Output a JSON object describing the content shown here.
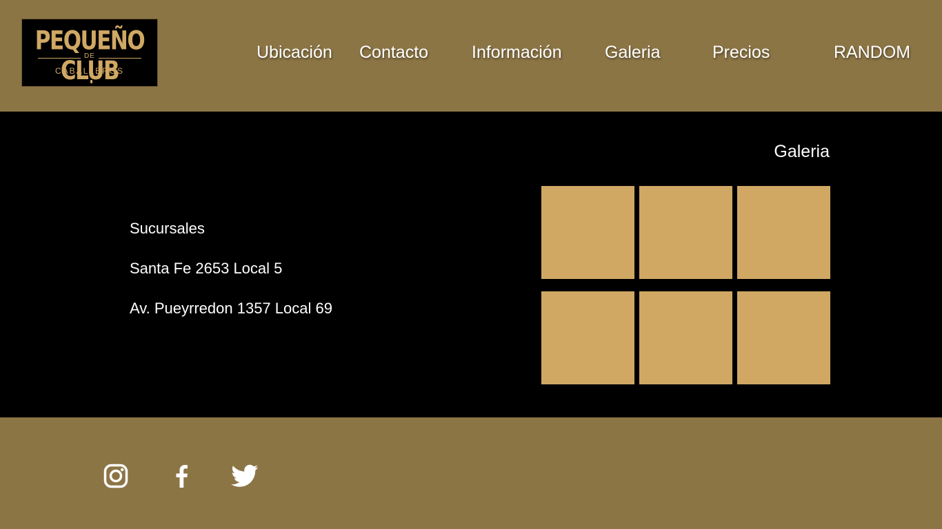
{
  "brand": {
    "logo_line1": "PEQUEÑO CLUB",
    "logo_line2": "DE",
    "logo_line3": "CABALLEROS"
  },
  "nav": {
    "items": [
      "Ubicación",
      "Contacto",
      "Información",
      "Galeria",
      "Precios",
      "RANDOM"
    ]
  },
  "locations": {
    "heading": "Sucursales",
    "addresses": [
      "Santa Fe 2653 Local 5",
      "Av. Pueyrredon 1357 Local 69"
    ]
  },
  "gallery": {
    "title": "Galeria",
    "tile_count": 6
  },
  "social": {
    "icons": [
      "instagram-icon",
      "facebook-icon",
      "twitter-icon"
    ]
  },
  "colors": {
    "header_footer_bg": "#8c7545",
    "main_bg": "#000000",
    "tile_gold": "#d0a864",
    "text": "#ffffff"
  }
}
